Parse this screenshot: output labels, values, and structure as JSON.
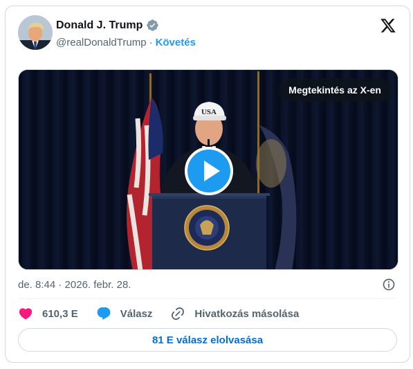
{
  "author": {
    "name": "Donald J. Trump",
    "handle": "@realDonaldTrump",
    "separator": "·",
    "follow_label": "Követés"
  },
  "media": {
    "view_on_x_label": "Megtekintés az X-en",
    "cap_text": "USA"
  },
  "tweet": {
    "timestamp": "de. 8:44 · 2026. febr. 28."
  },
  "actions": {
    "likes": "610,3 E",
    "reply_label": "Válasz",
    "copy_link_label": "Hivatkozás másolása"
  },
  "read_replies_label": "81 E válasz elolvasása",
  "colors": {
    "accent": "#1d9bf0",
    "like": "#f91880",
    "link_button": "#006fd6",
    "secondary_text": "#536471"
  },
  "icons": [
    "verified-badge-icon",
    "x-logo-icon",
    "play-icon",
    "info-icon",
    "heart-icon",
    "reply-bubble-icon",
    "link-icon"
  ]
}
